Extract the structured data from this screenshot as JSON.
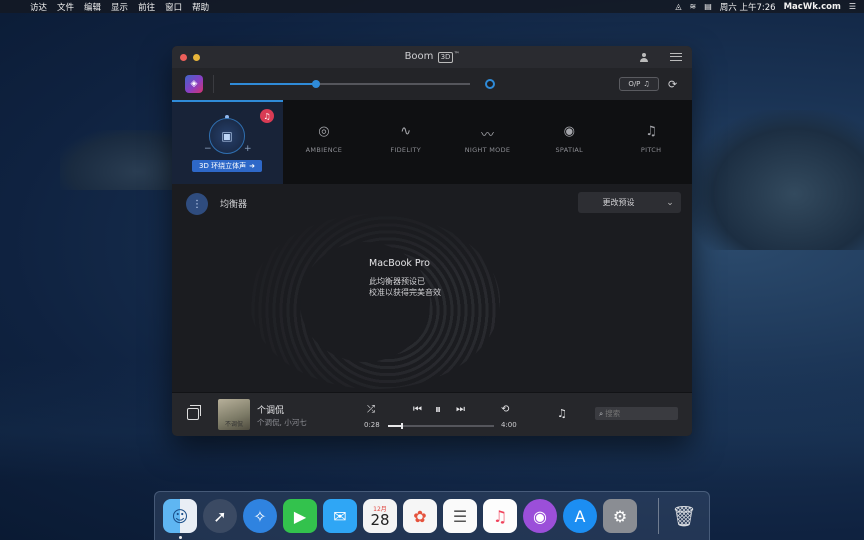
{
  "menubar": {
    "apple_icon": "apple-logo",
    "items": [
      "访达",
      "文件",
      "编辑",
      "显示",
      "前往",
      "窗口",
      "帮助"
    ],
    "clock": "周六 上午7:26",
    "site": "MacWk.com"
  },
  "window": {
    "title": "Boom",
    "title_badge": "3D",
    "title_tm": "™"
  },
  "volume": {
    "level": 0.36,
    "op_label": "O/P"
  },
  "effects": {
    "threeD_label": "3D 环绕立体声",
    "items": [
      {
        "label": "AMBIENCE",
        "icon": "ambience-icon"
      },
      {
        "label": "FIDELITY",
        "icon": "fidelity-icon"
      },
      {
        "label": "NIGHT MODE",
        "icon": "night-mode-icon"
      },
      {
        "label": "SPATIAL",
        "icon": "spatial-icon"
      },
      {
        "label": "PITCH",
        "icon": "pitch-icon"
      }
    ]
  },
  "equalizer": {
    "title": "均衡器",
    "preset_button": "更改预设",
    "device_name": "MacBook Pro",
    "device_note_line1": "此均衡器预设已",
    "device_note_line2": "校准以获得完美音效"
  },
  "player": {
    "album_caption": "不调侃",
    "track_title": "个调侃",
    "track_artist": "个调侃, 小河七",
    "elapsed": "0:28",
    "duration": "4:00",
    "progress": 0.12,
    "search_placeholder": "搜索"
  },
  "dock": {
    "calendar_month": "12月",
    "calendar_day": "28",
    "apps": [
      "finder",
      "launchpad",
      "safari",
      "facetime",
      "messages",
      "calendar",
      "photos",
      "reminders",
      "music",
      "podcasts",
      "app-store",
      "system-preferences",
      "trash"
    ]
  },
  "colors": {
    "accent": "#2f8bd8",
    "threeD_button": "#2e68c8",
    "headphone_badge": "#d83b54"
  }
}
